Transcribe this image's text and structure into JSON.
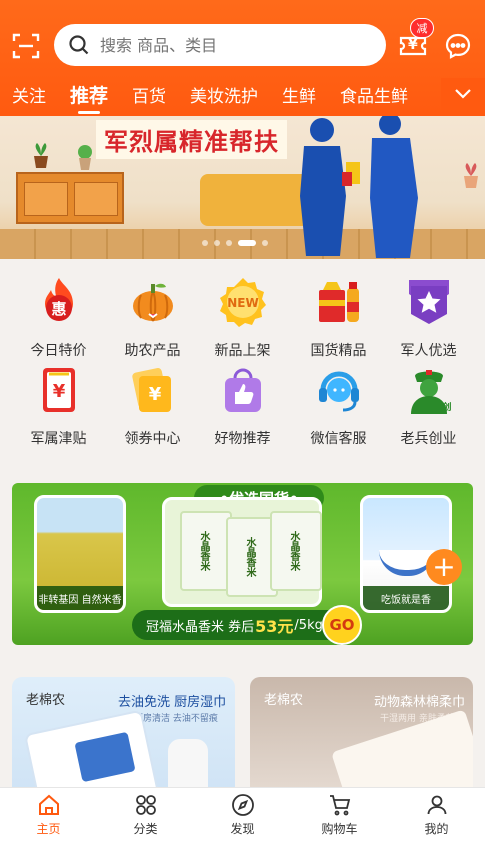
{
  "header": {
    "search_placeholder": "搜索 商品、类目",
    "coupon_badge": "减",
    "coupon_symbol": "¥"
  },
  "tabs": [
    "关注",
    "推荐",
    "百货",
    "美妆洗护",
    "生鲜",
    "食品生鲜"
  ],
  "active_tab": "推荐",
  "banner": {
    "title": "军烈属精准帮扶",
    "slide_count": 5,
    "active_slide": 4
  },
  "grid": [
    {
      "label": "今日特价",
      "icon": "hui-flame-icon"
    },
    {
      "label": "助农产品",
      "icon": "pumpkin-icon"
    },
    {
      "label": "新品上架",
      "icon": "new-badge-icon"
    },
    {
      "label": "国货精品",
      "icon": "goods-gift-icon"
    },
    {
      "label": "军人优选",
      "icon": "star-badge-icon"
    },
    {
      "label": "军属津贴",
      "icon": "allowance-envelope-icon"
    },
    {
      "label": "领券中心",
      "icon": "coupon-ticket-icon"
    },
    {
      "label": "好物推荐",
      "icon": "thumbs-up-bag-icon"
    },
    {
      "label": "微信客服",
      "icon": "headset-icon"
    },
    {
      "label": "老兵创业",
      "icon": "veteran-icon"
    }
  ],
  "promo": {
    "heading": "•优选国货•",
    "left_caption": "非转基因 自然米香",
    "right_caption": "吃饭就是香",
    "bag_text": "水晶香米",
    "deal_prefix": "冠福水晶香米 券后",
    "deal_price": "53元",
    "deal_suffix": "/5kg",
    "go": "GO",
    "plus": "+"
  },
  "cards": [
    {
      "brand": "老棉农",
      "title": "去油免洗 厨房湿巾",
      "subtitle": "厨房清洁 去油不留痕"
    },
    {
      "brand": "老棉农",
      "title": "动物森林棉柔巾",
      "subtitle": "干湿两用 亲肤柔软"
    }
  ],
  "tabbar": [
    {
      "label": "主页",
      "icon": "home-icon"
    },
    {
      "label": "分类",
      "icon": "category-icon"
    },
    {
      "label": "发现",
      "icon": "compass-icon"
    },
    {
      "label": "购物车",
      "icon": "cart-icon"
    },
    {
      "label": "我的",
      "icon": "profile-icon"
    }
  ],
  "colors": {
    "brand": "#ff5a10",
    "promo_green": "#5fb82c",
    "price_yellow": "#ffe24a"
  }
}
